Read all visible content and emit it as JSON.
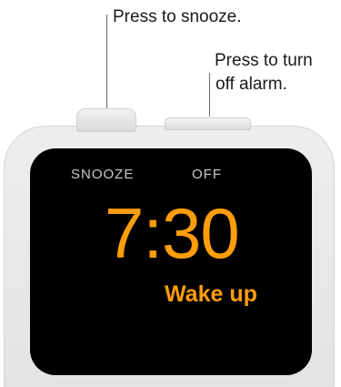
{
  "callouts": {
    "snooze": "Press to snooze.",
    "off_line1": "Press to turn",
    "off_line2": "off alarm."
  },
  "screen": {
    "snooze_label": "SNOOZE",
    "off_label": "OFF",
    "time": "7:30",
    "alarm_label": "Wake up"
  },
  "colors": {
    "accent": "#ff9d0a",
    "screen_bg": "#000000",
    "case": "#e6e6e6"
  }
}
